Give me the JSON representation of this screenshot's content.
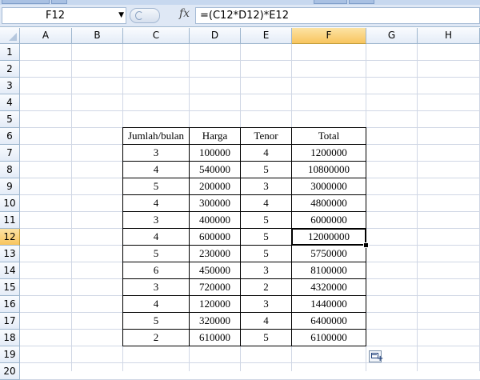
{
  "name_box": {
    "value": "F12"
  },
  "formula_bar": {
    "fx_label": "fx",
    "formula": "=(C12*D12)*E12"
  },
  "columns": [
    "A",
    "B",
    "C",
    "D",
    "E",
    "F",
    "G",
    "H"
  ],
  "rows": [
    "1",
    "2",
    "3",
    "4",
    "5",
    "6",
    "7",
    "8",
    "9",
    "10",
    "11",
    "12",
    "13",
    "14",
    "15",
    "16",
    "17",
    "18",
    "19",
    "20"
  ],
  "selected_cell": {
    "column": "F",
    "row": "12"
  },
  "table": {
    "headers": [
      "Jumlah/bulan",
      "Harga",
      "Tenor",
      "Total"
    ],
    "rows": [
      [
        "3",
        "100000",
        "4",
        "1200000"
      ],
      [
        "4",
        "540000",
        "5",
        "10800000"
      ],
      [
        "5",
        "200000",
        "3",
        "3000000"
      ],
      [
        "4",
        "300000",
        "4",
        "4800000"
      ],
      [
        "3",
        "400000",
        "5",
        "6000000"
      ],
      [
        "4",
        "600000",
        "5",
        "12000000"
      ],
      [
        "5",
        "230000",
        "5",
        "5750000"
      ],
      [
        "6",
        "450000",
        "3",
        "8100000"
      ],
      [
        "3",
        "720000",
        "2",
        "4320000"
      ],
      [
        "4",
        "120000",
        "3",
        "1440000"
      ],
      [
        "5",
        "320000",
        "4",
        "6400000"
      ],
      [
        "2",
        "610000",
        "5",
        "6100000"
      ]
    ]
  },
  "colors": {
    "header_selected": "#f8c55e",
    "gridline": "#d0d7e5",
    "header_border": "#9eb6ce"
  }
}
